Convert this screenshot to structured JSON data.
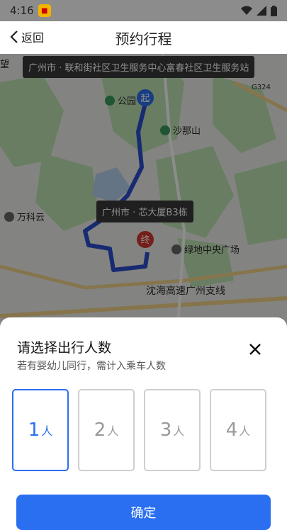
{
  "status": {
    "time": "4:16"
  },
  "nav": {
    "back_label": "返回",
    "title": "预约行程"
  },
  "map": {
    "start_label": "广州市 · 联和街社区卫生服务中心富春社区卫生服务站",
    "end_label": "广州市 · 芯大厦B3栋",
    "pins": {
      "start": "起",
      "end": "终"
    },
    "pois": [
      "公园",
      "沙那山",
      "万科云",
      "绿地中央广场"
    ],
    "road_label": "沈海高速广州支线",
    "road_code": "G324",
    "left_edge_text": "望"
  },
  "sheet": {
    "title": "请选择出行人数",
    "subtitle": "若有婴幼儿同行，需计入乘车人数",
    "options": [
      {
        "num": "1",
        "unit": "人"
      },
      {
        "num": "2",
        "unit": "人"
      },
      {
        "num": "3",
        "unit": "人"
      },
      {
        "num": "4",
        "unit": "人"
      }
    ],
    "selected_index": 0,
    "confirm_label": "确定"
  },
  "colors": {
    "accent": "#2a6ff0",
    "route": "#2d4fcf"
  }
}
